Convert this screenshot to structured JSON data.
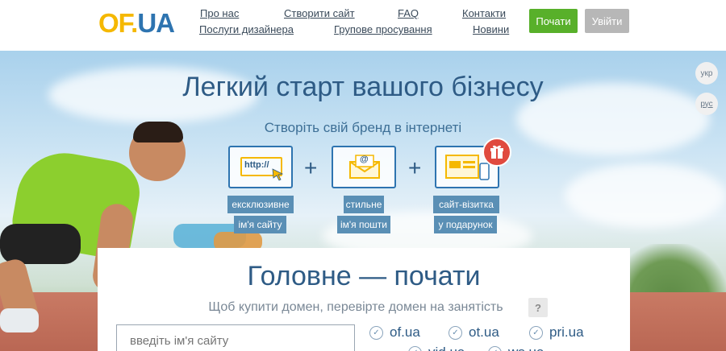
{
  "header": {
    "logo": {
      "part1": "OF",
      "dot": ".",
      "part2": "UA"
    },
    "nav": [
      {
        "label": "Про нас"
      },
      {
        "label": "Створити сайт"
      },
      {
        "label": "FAQ"
      },
      {
        "label": "Контакти"
      },
      {
        "label": "Послуги дизайнера"
      },
      {
        "label": "Групове просування"
      },
      {
        "label": "Новини"
      }
    ],
    "start_button": "Почати",
    "login_button": "Увійти"
  },
  "hero": {
    "title": "Легкий старт вашого бізнесу",
    "subtitle": "Створіть свій бренд в інтернеті",
    "features": [
      {
        "icon": "url-icon",
        "icon_text": "http://",
        "tags": [
          "ексклюзивне",
          "ім'я сайту"
        ]
      },
      {
        "icon": "email-icon",
        "icon_text": "@",
        "tags": [
          "стильне",
          "ім'я пошти"
        ]
      },
      {
        "icon": "website-icon",
        "tags": [
          "сайт-візитка",
          "у подарунок"
        ]
      }
    ],
    "plus": "+",
    "languages": [
      "укр",
      "рус"
    ]
  },
  "main": {
    "title": "Головне — почати",
    "subtitle": "Щоб купити домен, перевірте домен на занятість",
    "help": "?",
    "search_placeholder": "введіть ім'я сайту",
    "domains": [
      "of.ua",
      "ot.ua",
      "pri.ua",
      "vid.ua",
      "ws.ua"
    ]
  },
  "colors": {
    "accent": "#2e74b0",
    "logo_yellow": "#f5b800",
    "start_green": "#58b02a",
    "gift_red": "#e04a3f"
  }
}
